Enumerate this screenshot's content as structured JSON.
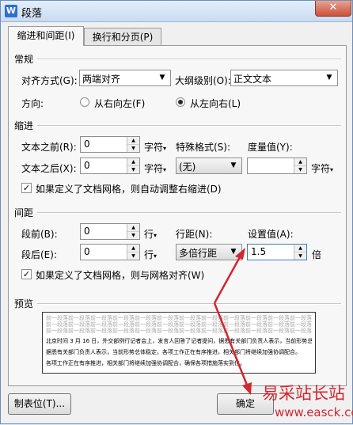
{
  "window": {
    "title": "段落",
    "app_icon_letter": "W",
    "close_symbol": "✕"
  },
  "tabs": [
    {
      "label": "缩进和间距(I)",
      "active": true
    },
    {
      "label": "换行和分页(P)",
      "active": false
    }
  ],
  "general": {
    "heading": "常规",
    "alignment_label": "对齐方式(G):",
    "alignment_value": "两端对齐",
    "outline_label": "大纲级别(O):",
    "outline_value": "正文文本",
    "direction_label": "方向:",
    "direction_rtl": "从右向左(F)",
    "direction_ltr": "从左向右(L)",
    "direction_selected": "ltr"
  },
  "indent": {
    "heading": "缩进",
    "before_label": "文本之前(R):",
    "before_value": "0",
    "before_unit": "字符",
    "after_label": "文本之后(X):",
    "after_value": "0",
    "after_unit": "字符",
    "special_label": "特殊格式(S):",
    "special_value": "(无)",
    "measure_label": "度量值(Y):",
    "measure_value": "",
    "measure_unit": "字符",
    "grid_checkbox_label": "如果定义了文档网格，则自动调整右缩进(D)",
    "grid_checked": true
  },
  "spacing": {
    "heading": "间距",
    "before_label": "段前(B):",
    "before_value": "0",
    "before_unit": "行",
    "after_label": "段后(E):",
    "after_value": "0",
    "after_unit": "行",
    "line_label": "行距(N):",
    "line_value": "多倍行距",
    "setting_label": "设置值(A):",
    "setting_value": "1.5",
    "setting_unit": "倍",
    "grid_checkbox_label": "如果定义了文档网格，则与网格对齐(W)",
    "grid_checked": true
  },
  "preview": {
    "heading": "预览",
    "prev_para_line": "前一段落前一段落前一段落前一段落前一段落前一段落前一段落前一段落前一段落前一段落前一段落前一段落前一段落前一段落",
    "sample_line_1": "北京时间 3 月 16 日，外交部例行记者会上，发言人回答了记者提问，据悉有关部门负责人表示，当前形势总体稳定。",
    "sample_line_2": "据悉有关部门负责人表示，当前形势总体稳定，各项工作正在有序推进，相关部门将继续加强协调配合。",
    "sample_line_3": "各项工作正在有序推进，相关部门将继续加强协调配合，确保各项措施落实到位。"
  },
  "buttons": {
    "tabs_button": "制表位(T)...",
    "ok_button": "确定"
  },
  "watermark": {
    "text": "易采站长站",
    "url": "www.easck.com"
  },
  "colors": {
    "annotation_red": "#d3262f",
    "highlight_blue": "#3c7fb1"
  }
}
